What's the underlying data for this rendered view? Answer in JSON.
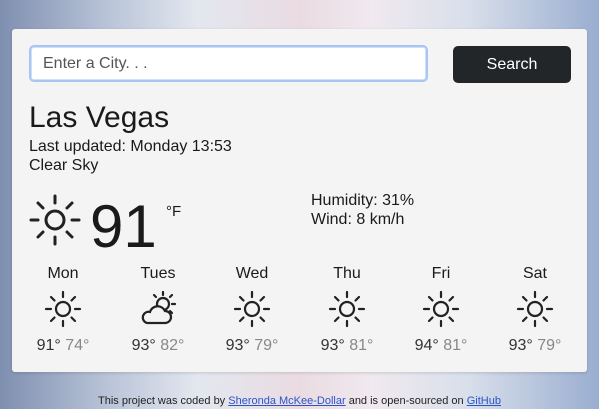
{
  "search": {
    "placeholder": "Enter a City. . .",
    "button_label": "Search"
  },
  "current": {
    "city": "Las Vegas",
    "updated": "Last updated: Monday 13:53",
    "description": "Clear Sky",
    "icon": "sun-icon",
    "temperature": "91",
    "unit": "°F",
    "humidity": "Humidity: 31%",
    "wind": "Wind: 8 km/h"
  },
  "forecast": [
    {
      "day": "Mon",
      "icon": "sun-icon",
      "high": "91°",
      "low": "74°"
    },
    {
      "day": "Tues",
      "icon": "partly-cloudy-icon",
      "high": "93°",
      "low": "82°"
    },
    {
      "day": "Wed",
      "icon": "sun-icon",
      "high": "93°",
      "low": "79°"
    },
    {
      "day": "Thu",
      "icon": "sun-icon",
      "high": "93°",
      "low": "81°"
    },
    {
      "day": "Fri",
      "icon": "sun-icon",
      "high": "94°",
      "low": "81°"
    },
    {
      "day": "Sat",
      "icon": "sun-icon",
      "high": "93°",
      "low": "79°"
    }
  ],
  "footer": {
    "prefix": "This project was coded by ",
    "author_link": "Sheronda McKee-Dollar",
    "middle": " and is open-sourced on ",
    "repo_link": "GitHub"
  },
  "colors": {
    "button_bg": "#222629",
    "link": "#2a54c9",
    "card_bg": "#f4f4f4"
  }
}
